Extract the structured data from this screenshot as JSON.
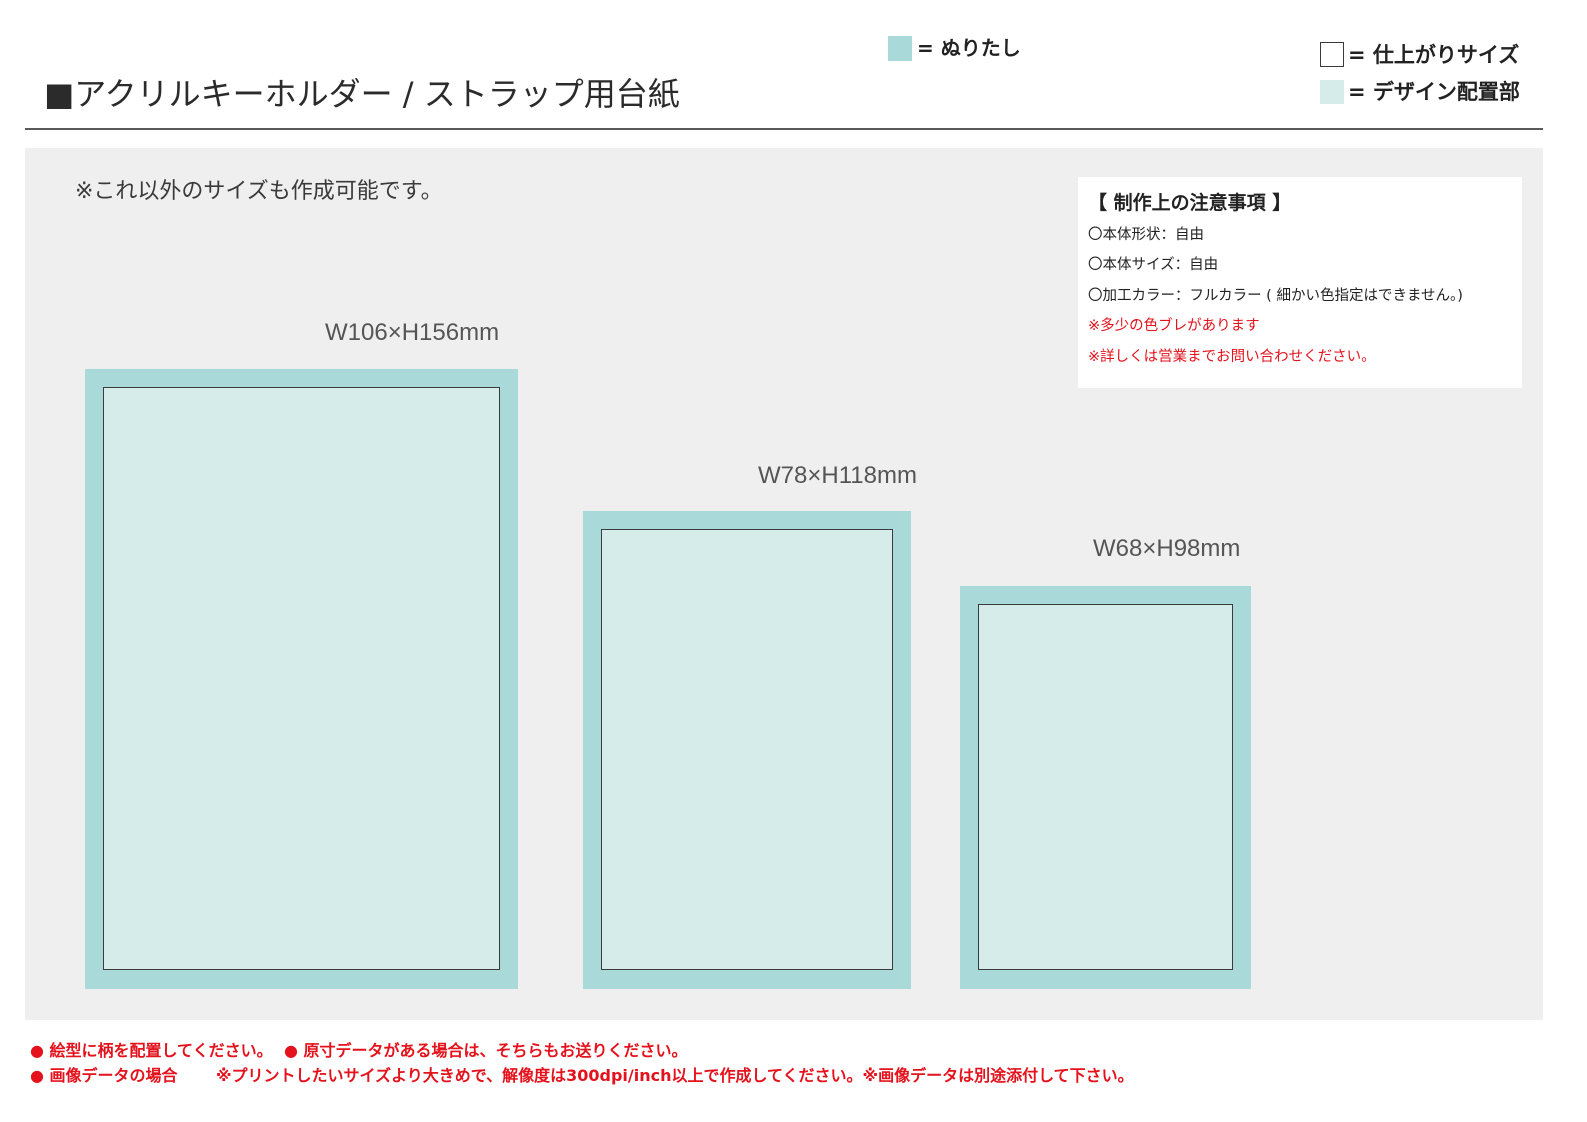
{
  "header": {
    "title": "■アクリルキーホルダー / ストラップ用台紙"
  },
  "legend": {
    "bleed": {
      "label": "= ぬりたし"
    },
    "trim": {
      "label": "= 仕上がりサイズ"
    },
    "design": {
      "label": "= デザイン配置部"
    }
  },
  "colors": {
    "bleed": "#a9d9d8",
    "design_area": "#d6ecea",
    "panel": "#eeefee",
    "trim_line": "#3a3a3a",
    "notice_red": "#e4121c"
  },
  "panel": {
    "note": "※これ以外のサイズも作成可能です。",
    "templates": [
      {
        "size_label": "W106×H156mm"
      },
      {
        "size_label": "W78×H118mm"
      },
      {
        "size_label": "W68×H98mm"
      }
    ]
  },
  "notes": {
    "heading": "【 制作上の注意事項 】",
    "items": [
      "〇本体形状：自由",
      "〇本体サイズ：自由",
      "〇加工カラー：フルカラー ( 細かい色指定はできません。)"
    ],
    "warnings": [
      "※多少の色ブレがあります",
      "※詳しくは営業までお問い合わせください。"
    ]
  },
  "footer": {
    "line1": [
      "● 絵型に柄を配置してください。",
      "● 原寸データがある場合は、そちらもお送りください。"
    ],
    "line2": [
      "● 画像データの場合",
      "※プリントしたいサイズより大きめで、解像度は300dpi/inch以上で作成してください。※画像データは別途添付して下さい。"
    ]
  }
}
